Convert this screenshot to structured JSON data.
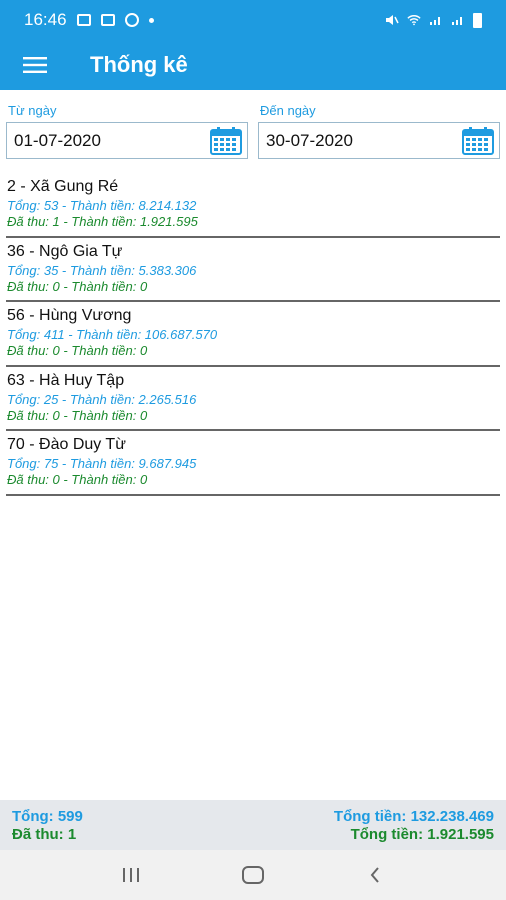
{
  "status_bar": {
    "time": "16:46"
  },
  "app_bar": {
    "title": "Thống kê"
  },
  "filter": {
    "from_label": "Từ ngày",
    "from_value": "01-07-2020",
    "to_label": "Đến ngày",
    "to_value": "30-07-2020"
  },
  "items": [
    {
      "name": "2 - Xã Gung Ré",
      "line1": "Tổng: 53 - Thành tiền: 8.214.132",
      "line2": "Đã thu: 1 - Thành tiền: 1.921.595"
    },
    {
      "name": "36 - Ngô Gia Tự",
      "line1": "Tổng: 35 - Thành tiền: 5.383.306",
      "line2": "Đã thu: 0 - Thành tiền: 0"
    },
    {
      "name": "56 - Hùng Vương",
      "line1": "Tổng: 411 - Thành tiền: 106.687.570",
      "line2": "Đã thu: 0 - Thành tiền: 0"
    },
    {
      "name": "63 - Hà Huy Tập",
      "line1": "Tổng: 25 - Thành tiền: 2.265.516",
      "line2": "Đã thu: 0 - Thành tiền: 0"
    },
    {
      "name": "70 - Đào Duy Từ",
      "line1": "Tổng: 75 - Thành tiền: 9.687.945",
      "line2": "Đã thu: 0 - Thành tiền: 0"
    }
  ],
  "footer": {
    "total": "Tổng: 599",
    "total_amount": "Tổng tiền: 132.238.469",
    "collected": "Đã thu: 1",
    "collected_amount": "Tổng tiền: 1.921.595"
  },
  "icons": {
    "menu": "menu-icon",
    "calendar": "calendar-icon",
    "recents": "recents-icon",
    "home": "home-icon",
    "back": "back-icon"
  },
  "colors": {
    "primary": "#1e9be0",
    "collected": "#1b8a2e"
  }
}
